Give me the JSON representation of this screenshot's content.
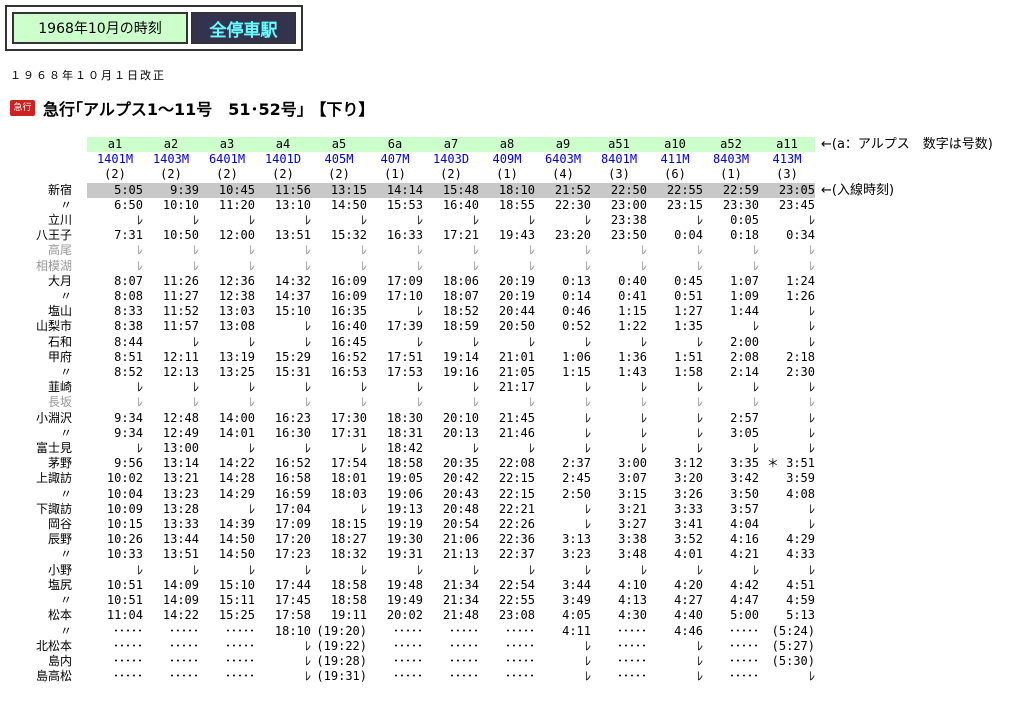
{
  "nav": {
    "link_label": "1968年10月の時刻",
    "current_label": "全停車駅"
  },
  "revision": "１９６８年１０月１日改正",
  "badge": "急行",
  "title": "急行｢アルプス1～11号　51･52号｣ 【下り】",
  "header_note": "←(a：アルプス　数字は号数)",
  "first_note": "←(入線時刻)",
  "trains": [
    "a1",
    "a2",
    "a3",
    "a4",
    "a5",
    "6a",
    "a7",
    "a8",
    "a9",
    "a51",
    "a10",
    "a52",
    "a11"
  ],
  "numbers": [
    "1401M",
    "1403M",
    "6401M",
    "1401D",
    "405M",
    "407M",
    "1403D",
    "409M",
    "6403M",
    "8401M",
    "411M",
    "8403M",
    "413M"
  ],
  "cars": [
    "(2)",
    "(2)",
    "(2)",
    "(2)",
    "(2)",
    "(1)",
    "(2)",
    "(1)",
    "(4)",
    "(3)",
    "(6)",
    "(1)",
    "(3)"
  ],
  "rows": [
    {
      "station": "新宿",
      "gray": false,
      "first": true,
      "times": [
        "5:05",
        "9:39",
        "10:45",
        "11:56",
        "13:15",
        "14:14",
        "15:48",
        "18:10",
        "21:52",
        "22:50",
        "22:55",
        "22:59",
        "23:05"
      ]
    },
    {
      "station": "〃",
      "gray": false,
      "times": [
        "6:50",
        "10:10",
        "11:20",
        "13:10",
        "14:50",
        "15:53",
        "16:40",
        "18:55",
        "22:30",
        "23:00",
        "23:15",
        "23:30",
        "23:45"
      ]
    },
    {
      "station": "立川",
      "gray": false,
      "times": [
        "ﾚ",
        "ﾚ",
        "ﾚ",
        "ﾚ",
        "ﾚ",
        "ﾚ",
        "ﾚ",
        "ﾚ",
        "ﾚ",
        "23:38",
        "ﾚ",
        "0:05",
        "ﾚ"
      ]
    },
    {
      "station": "八王子",
      "gray": false,
      "times": [
        "7:31",
        "10:50",
        "12:00",
        "13:51",
        "15:32",
        "16:33",
        "17:21",
        "19:43",
        "23:20",
        "23:50",
        "0:04",
        "0:18",
        "0:34"
      ]
    },
    {
      "station": "高尾",
      "gray": true,
      "times": [
        "ﾚ",
        "ﾚ",
        "ﾚ",
        "ﾚ",
        "ﾚ",
        "ﾚ",
        "ﾚ",
        "ﾚ",
        "ﾚ",
        "ﾚ",
        "ﾚ",
        "ﾚ",
        "ﾚ"
      ]
    },
    {
      "station": "相模湖",
      "gray": true,
      "times": [
        "ﾚ",
        "ﾚ",
        "ﾚ",
        "ﾚ",
        "ﾚ",
        "ﾚ",
        "ﾚ",
        "ﾚ",
        "ﾚ",
        "ﾚ",
        "ﾚ",
        "ﾚ",
        "ﾚ"
      ]
    },
    {
      "station": "大月",
      "gray": false,
      "times": [
        "8:07",
        "11:26",
        "12:36",
        "14:32",
        "16:09",
        "17:09",
        "18:06",
        "20:19",
        "0:13",
        "0:40",
        "0:45",
        "1:07",
        "1:24"
      ]
    },
    {
      "station": "〃",
      "gray": false,
      "times": [
        "8:08",
        "11:27",
        "12:38",
        "14:37",
        "16:09",
        "17:10",
        "18:07",
        "20:19",
        "0:14",
        "0:41",
        "0:51",
        "1:09",
        "1:26"
      ]
    },
    {
      "station": "塩山",
      "gray": false,
      "times": [
        "8:33",
        "11:52",
        "13:03",
        "15:10",
        "16:35",
        "ﾚ",
        "18:52",
        "20:44",
        "0:46",
        "1:15",
        "1:27",
        "1:44",
        "ﾚ"
      ]
    },
    {
      "station": "山梨市",
      "gray": false,
      "times": [
        "8:38",
        "11:57",
        "13:08",
        "ﾚ",
        "16:40",
        "17:39",
        "18:59",
        "20:50",
        "0:52",
        "1:22",
        "1:35",
        "ﾚ",
        "ﾚ"
      ]
    },
    {
      "station": "石和",
      "gray": false,
      "times": [
        "8:44",
        "ﾚ",
        "ﾚ",
        "ﾚ",
        "16:45",
        "ﾚ",
        "ﾚ",
        "ﾚ",
        "ﾚ",
        "ﾚ",
        "ﾚ",
        "2:00",
        "ﾚ"
      ]
    },
    {
      "station": "甲府",
      "gray": false,
      "times": [
        "8:51",
        "12:11",
        "13:19",
        "15:29",
        "16:52",
        "17:51",
        "19:14",
        "21:01",
        "1:06",
        "1:36",
        "1:51",
        "2:08",
        "2:18"
      ]
    },
    {
      "station": "〃",
      "gray": false,
      "times": [
        "8:52",
        "12:13",
        "13:25",
        "15:31",
        "16:53",
        "17:53",
        "19:16",
        "21:05",
        "1:15",
        "1:43",
        "1:58",
        "2:14",
        "2:30"
      ]
    },
    {
      "station": "韮崎",
      "gray": false,
      "times": [
        "ﾚ",
        "ﾚ",
        "ﾚ",
        "ﾚ",
        "ﾚ",
        "ﾚ",
        "ﾚ",
        "21:17",
        "ﾚ",
        "ﾚ",
        "ﾚ",
        "ﾚ",
        "ﾚ"
      ]
    },
    {
      "station": "長坂",
      "gray": true,
      "times": [
        "ﾚ",
        "ﾚ",
        "ﾚ",
        "ﾚ",
        "ﾚ",
        "ﾚ",
        "ﾚ",
        "ﾚ",
        "ﾚ",
        "ﾚ",
        "ﾚ",
        "ﾚ",
        "ﾚ"
      ]
    },
    {
      "station": "小淵沢",
      "gray": false,
      "times": [
        "9:34",
        "12:48",
        "14:00",
        "16:23",
        "17:30",
        "18:30",
        "20:10",
        "21:45",
        "ﾚ",
        "ﾚ",
        "ﾚ",
        "2:57",
        "ﾚ"
      ]
    },
    {
      "station": "〃",
      "gray": false,
      "times": [
        "9:34",
        "12:49",
        "14:01",
        "16:30",
        "17:31",
        "18:31",
        "20:13",
        "21:46",
        "ﾚ",
        "ﾚ",
        "ﾚ",
        "3:05",
        "ﾚ"
      ]
    },
    {
      "station": "富士見",
      "gray": false,
      "times": [
        "ﾚ",
        "13:00",
        "ﾚ",
        "ﾚ",
        "ﾚ",
        "18:42",
        "ﾚ",
        "ﾚ",
        "ﾚ",
        "ﾚ",
        "ﾚ",
        "ﾚ",
        "ﾚ"
      ]
    },
    {
      "station": "茅野",
      "gray": false,
      "times": [
        "9:56",
        "13:14",
        "14:22",
        "16:52",
        "17:54",
        "18:58",
        "20:35",
        "22:08",
        "2:37",
        "3:00",
        "3:12",
        "3:35",
        "＊ 3:51"
      ]
    },
    {
      "station": "上諏訪",
      "gray": false,
      "times": [
        "10:02",
        "13:21",
        "14:28",
        "16:58",
        "18:01",
        "19:05",
        "20:42",
        "22:15",
        "2:45",
        "3:07",
        "3:20",
        "3:42",
        "3:59"
      ]
    },
    {
      "station": "〃",
      "gray": false,
      "times": [
        "10:04",
        "13:23",
        "14:29",
        "16:59",
        "18:03",
        "19:06",
        "20:43",
        "22:15",
        "2:50",
        "3:15",
        "3:26",
        "3:50",
        "4:08"
      ]
    },
    {
      "station": "下諏訪",
      "gray": false,
      "times": [
        "10:09",
        "13:28",
        "ﾚ",
        "17:04",
        "ﾚ",
        "19:13",
        "20:48",
        "22:21",
        "ﾚ",
        "3:21",
        "3:33",
        "3:57",
        "ﾚ"
      ]
    },
    {
      "station": "岡谷",
      "gray": false,
      "times": [
        "10:15",
        "13:33",
        "14:39",
        "17:09",
        "18:15",
        "19:19",
        "20:54",
        "22:26",
        "ﾚ",
        "3:27",
        "3:41",
        "4:04",
        "ﾚ"
      ]
    },
    {
      "station": "辰野",
      "gray": false,
      "times": [
        "10:26",
        "13:44",
        "14:50",
        "17:20",
        "18:27",
        "19:30",
        "21:06",
        "22:36",
        "3:13",
        "3:38",
        "3:52",
        "4:16",
        "4:29"
      ]
    },
    {
      "station": "〃",
      "gray": false,
      "times": [
        "10:33",
        "13:51",
        "14:50",
        "17:23",
        "18:32",
        "19:31",
        "21:13",
        "22:37",
        "3:23",
        "3:48",
        "4:01",
        "4:21",
        "4:33"
      ]
    },
    {
      "station": "小野",
      "gray": false,
      "times": [
        "ﾚ",
        "ﾚ",
        "ﾚ",
        "ﾚ",
        "ﾚ",
        "ﾚ",
        "ﾚ",
        "ﾚ",
        "ﾚ",
        "ﾚ",
        "ﾚ",
        "ﾚ",
        "ﾚ"
      ]
    },
    {
      "station": "塩尻",
      "gray": false,
      "times": [
        "10:51",
        "14:09",
        "15:10",
        "17:44",
        "18:58",
        "19:48",
        "21:34",
        "22:54",
        "3:44",
        "4:10",
        "4:20",
        "4:42",
        "4:51"
      ]
    },
    {
      "station": "〃",
      "gray": false,
      "times": [
        "10:51",
        "14:09",
        "15:11",
        "17:45",
        "18:58",
        "19:49",
        "21:34",
        "22:55",
        "3:49",
        "4:13",
        "4:27",
        "4:47",
        "4:59"
      ]
    },
    {
      "station": "松本",
      "gray": false,
      "times": [
        "11:04",
        "14:22",
        "15:25",
        "17:58",
        "19:11",
        "20:02",
        "21:48",
        "23:08",
        "4:05",
        "4:30",
        "4:40",
        "5:00",
        "5:13"
      ]
    },
    {
      "station": "〃",
      "gray": false,
      "times": [
        "･････",
        "･････",
        "･････",
        "18:10",
        "(19:20)",
        "･････",
        "･････",
        "･････",
        "4:11",
        "･････",
        "4:46",
        "･････",
        "(5:24)"
      ]
    },
    {
      "station": "北松本",
      "gray": false,
      "times": [
        "･････",
        "･････",
        "･････",
        "ﾚ",
        "(19:22)",
        "･････",
        "･････",
        "･････",
        "ﾚ",
        "･････",
        "ﾚ",
        "･････",
        "(5:27)"
      ]
    },
    {
      "station": "島内",
      "gray": false,
      "times": [
        "･････",
        "･････",
        "･････",
        "ﾚ",
        "(19:28)",
        "･････",
        "･････",
        "･････",
        "ﾚ",
        "･････",
        "ﾚ",
        "･････",
        "(5:30)"
      ]
    },
    {
      "station": "島高松",
      "gray": false,
      "times": [
        "･････",
        "･････",
        "･････",
        "ﾚ",
        "(19:31)",
        "･････",
        "･････",
        "･････",
        "ﾚ",
        "･････",
        "ﾚ",
        "･････",
        "ﾚ"
      ]
    }
  ]
}
